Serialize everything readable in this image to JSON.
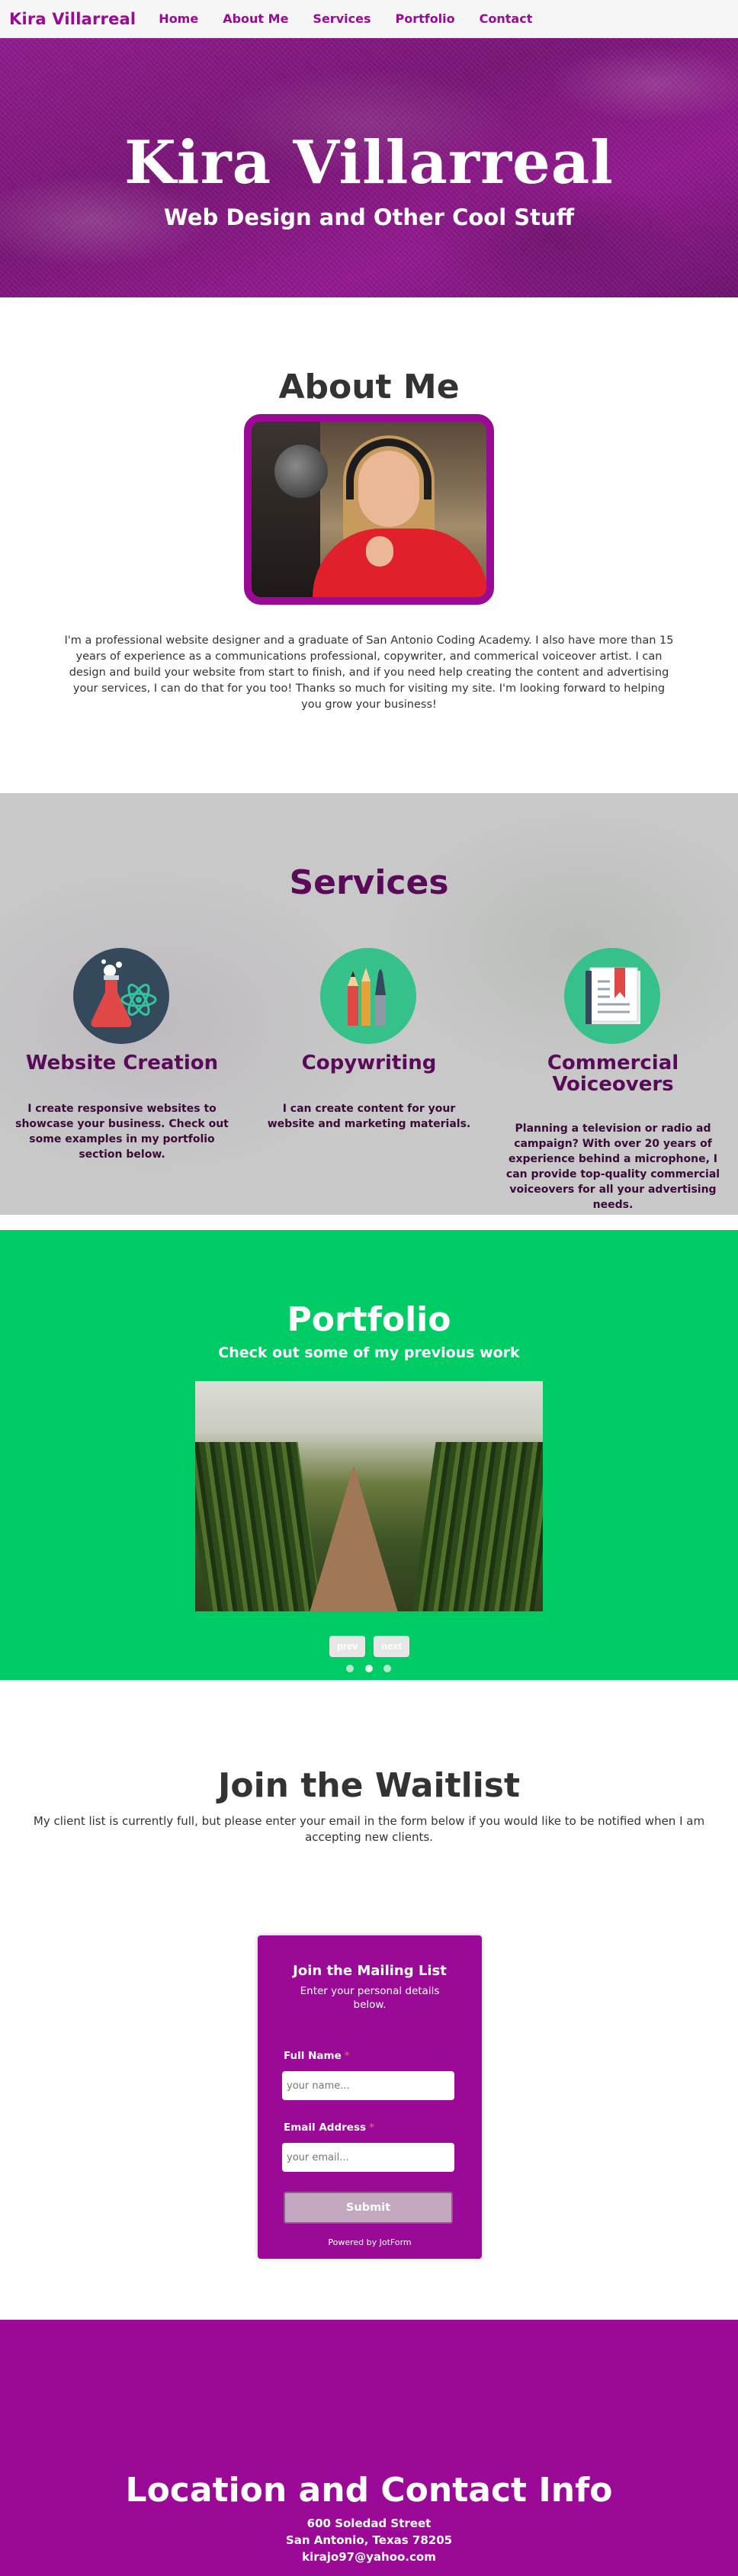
{
  "nav": {
    "brand": "Kira Villarreal",
    "links": [
      "Home",
      "About Me",
      "Services",
      "Portfolio",
      "Contact"
    ]
  },
  "hero": {
    "title": "Kira Villarreal",
    "subtitle": "Web Design and Other Cool Stuff"
  },
  "about": {
    "title": "About Me",
    "text": "I'm a professional website designer and a graduate of San Antonio Coding Academy. I also have more than 15 years of experience as a communications professional, copywriter, and commerical voiceover artist. I can design and build your website from start to finish, and if you need help creating the content and advertising your services, I can do that for you too! Thanks so much for visiting my site. I'm looking forward to helping you grow your business!"
  },
  "services": {
    "title": "Services",
    "items": [
      {
        "title": "Website Creation",
        "text": "I create responsive websites to showcase your business. Check out some examples in my portfolio section below.",
        "icon": "science-flask-icon"
      },
      {
        "title": "Copywriting",
        "text": "I can create content for your website and marketing materials.",
        "icon": "pencil-brush-icon"
      },
      {
        "title": "Commercial Voiceovers",
        "text": "Planning a television or radio ad campaign? With over 20 years of experience behind a microphone, I can provide top-quality commercial voiceovers for all your advertising needs.",
        "icon": "book-icon"
      }
    ]
  },
  "portfolio": {
    "title": "Portfolio",
    "subtitle": "Check out some of my previous work",
    "prev_label": "prev",
    "next_label": "next",
    "slide_count": 3,
    "active_slide": 2
  },
  "waitlist": {
    "title": "Join the Waitlist",
    "text": "My client list is currently full, but please enter your email in the form below if you would like to be notified when I am accepting new clients."
  },
  "form": {
    "title": "Join the Mailing List",
    "subtitle": "Enter your personal details below.",
    "name_label": "Full Name",
    "name_placeholder": "your name...",
    "email_label": "Email Address",
    "email_placeholder": "your email...",
    "required_mark": "*",
    "submit_label": "Submit",
    "powered_by": "Powered by JotForm"
  },
  "contact": {
    "title": "Location and Contact Info",
    "address1": "600 Soledad Street",
    "address2": "San Antonio, Texas 78205",
    "email": "kirajo97@yahoo.com"
  },
  "colors": {
    "brand_purple": "#9b0a96",
    "dark_purple": "#5a0a58",
    "portfolio_green": "#00cc66",
    "services_gray": "#c8c8c8"
  }
}
